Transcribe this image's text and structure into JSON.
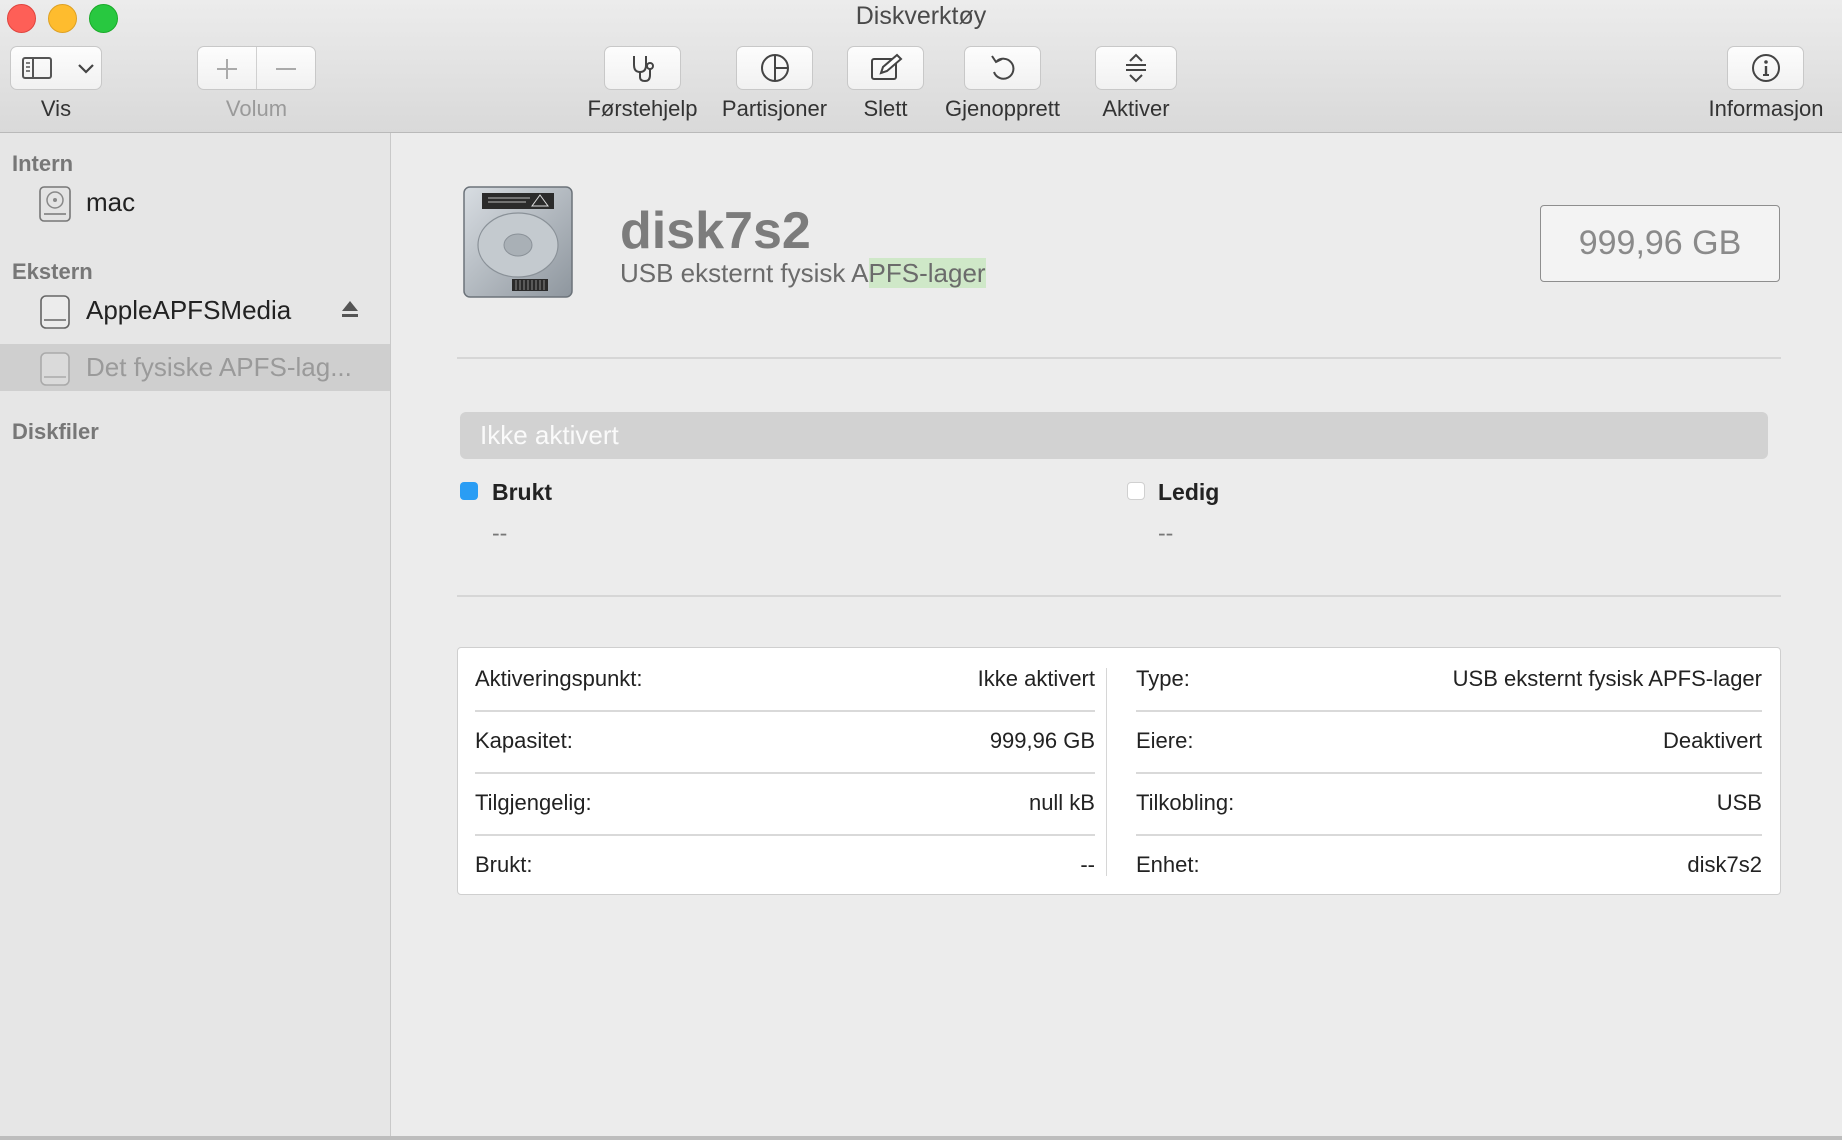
{
  "window": {
    "title": "Diskverktøy"
  },
  "toolbar": {
    "vis_label": "Vis",
    "volum_label": "Volum",
    "forstehjelp_label": "Førstehjelp",
    "partisjoner_label": "Partisjoner",
    "slett_label": "Slett",
    "gjenopprett_label": "Gjenopprett",
    "aktiver_label": "Aktiver",
    "informasjon_label": "Informasjon"
  },
  "sidebar": {
    "sections": [
      {
        "title": "Intern"
      },
      {
        "title": "Ekstern"
      },
      {
        "title": "Diskfiler"
      }
    ],
    "items": [
      {
        "label": "mac",
        "icon": "internal-disk-icon"
      },
      {
        "label": "AppleAPFSMedia",
        "icon": "external-disk-icon"
      },
      {
        "label": "Det fysiske APFS-lag...",
        "icon": "external-disk-icon",
        "selected": true
      }
    ]
  },
  "disk": {
    "name": "disk7s2",
    "subtitle_a": "USB eksternt fysisk A",
    "subtitle_b": "PFS-lager",
    "capacity": "999,96 GB"
  },
  "usage": {
    "bar_label": "Ikke aktivert",
    "used_label": "Brukt",
    "used_value": "--",
    "used_color": "#2a9df4",
    "free_label": "Ledig",
    "free_value": "--",
    "free_color": "#ffffff"
  },
  "info": {
    "left": [
      {
        "key": "Aktiveringspunkt:",
        "value": "Ikke aktivert"
      },
      {
        "key": "Kapasitet:",
        "value": "999,96 GB"
      },
      {
        "key": "Tilgjengelig:",
        "value": "null kB"
      },
      {
        "key": "Brukt:",
        "value": "--"
      }
    ],
    "right": [
      {
        "key": "Type:",
        "value": "USB eksternt fysisk APFS-lager"
      },
      {
        "key": "Eiere:",
        "value": "Deaktivert"
      },
      {
        "key": "Tilkobling:",
        "value": "USB"
      },
      {
        "key": "Enhet:",
        "value": "disk7s2"
      }
    ]
  }
}
